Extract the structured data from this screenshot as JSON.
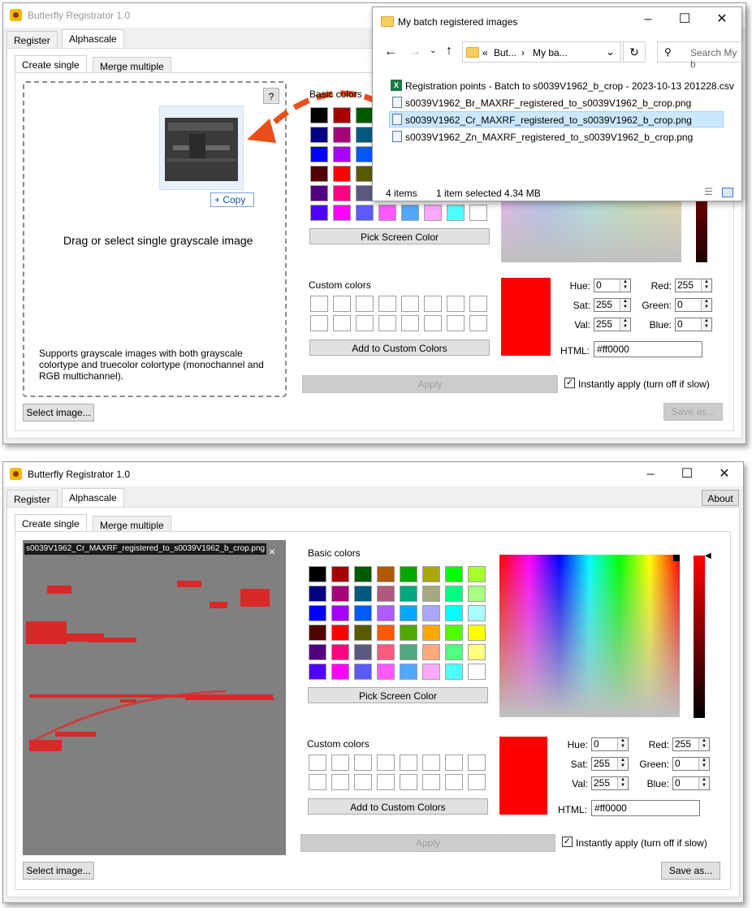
{
  "app": {
    "title": "Butterfly Registrator 1.0",
    "about_label": "About"
  },
  "tabs": {
    "register": "Register",
    "alphascale": "Alphascale",
    "create_single": "Create single",
    "merge_multiple": "Merge multiple"
  },
  "top": {
    "help_label": "?",
    "copy_label": "+ Copy",
    "drop_text": "Drag or select single grayscale image",
    "supports_text": "Supports grayscale images with both grayscale colortype and truecolor colortype (monochannel and RGB multichannel).",
    "select_image_label": "Select image...",
    "basic_colors_label": "Basic colors",
    "pick_screen_label": "Pick Screen Color",
    "custom_colors_label": "Custom colors",
    "add_custom_label": "Add to Custom Colors",
    "apply_label": "Apply",
    "instantly_label": "Instantly apply (turn off if slow)",
    "save_as_label": "Save as..."
  },
  "explorer": {
    "title": "My batch registered images",
    "crumb1": "But...",
    "crumb2": "My ba...",
    "search_placeholder": "Search My b",
    "files": [
      "Registration points - Batch to s0039V1962_b_crop - 2023-10-13 201228.csv",
      "s0039V1962_Br_MAXRF_registered_to_s0039V1962_b_crop.png",
      "s0039V1962_Cr_MAXRF_registered_to_s0039V1962_b_crop.png",
      "s0039V1962_Zn_MAXRF_registered_to_s0039V1962_b_crop.png"
    ],
    "items_count": "4 items",
    "selected_info": "1 item selected  4.34 MB"
  },
  "bottom": {
    "image_filename": "s0039V1962_Cr_MAXRF_registered_to_s0039V1962_b_crop.png",
    "close_glyph": "×",
    "select_image_label": "Select image...",
    "basic_colors_label": "Basic colors",
    "pick_screen_label": "Pick Screen Color",
    "custom_colors_label": "Custom colors",
    "add_custom_label": "Add to Custom Colors",
    "apply_label": "Apply",
    "instantly_label": "Instantly apply (turn off if slow)",
    "save_as_label": "Save as..."
  },
  "color_fields": {
    "hue_label": "Hue:",
    "hue": "0",
    "sat_label": "Sat:",
    "sat": "255",
    "val_label": "Val:",
    "val": "255",
    "red_label": "Red:",
    "red": "255",
    "green_label": "Green:",
    "green": "0",
    "blue_label": "Blue:",
    "blue": "0",
    "html_label": "HTML:",
    "html": "#ff0000"
  },
  "colors": {
    "selected": "#ff0000",
    "basic": [
      "#000000",
      "#a80000",
      "#005a00",
      "#b05a00",
      "#00a800",
      "#a8a800",
      "#00ff00",
      "#a8ff30",
      "#000080",
      "#a8007a",
      "#005a80",
      "#b05a80",
      "#00a880",
      "#a8a880",
      "#00ff80",
      "#a8ff80",
      "#0000ff",
      "#a800ff",
      "#005aff",
      "#b05aff",
      "#00a8ff",
      "#a8a8ff",
      "#00ffff",
      "#a8ffff",
      "#500000",
      "#ff0000",
      "#5a5a00",
      "#ff5a00",
      "#50a800",
      "#ffa800",
      "#50ff00",
      "#ffff00",
      "#500080",
      "#ff0080",
      "#5a5a80",
      "#ff5a80",
      "#50a880",
      "#ffa880",
      "#50ff80",
      "#ffff80",
      "#5000ff",
      "#ff00ff",
      "#5a5aff",
      "#ff5aff",
      "#50a8ff",
      "#ffa8ff",
      "#50ffff",
      "#ffffff"
    ]
  }
}
